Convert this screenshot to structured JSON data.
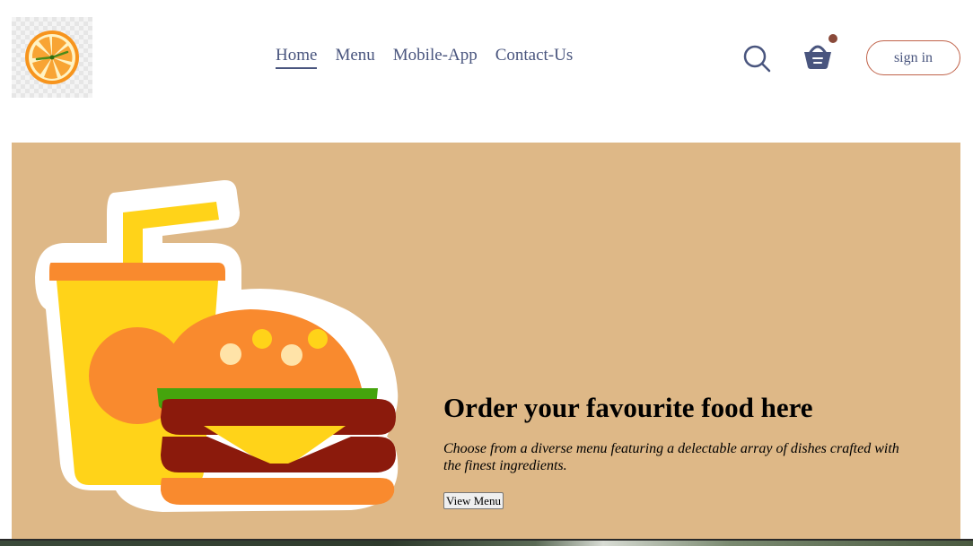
{
  "header": {
    "logo_icon": "orange-clock-logo",
    "nav": [
      {
        "label": "Home",
        "active": true
      },
      {
        "label": "Menu",
        "active": false
      },
      {
        "label": "Mobile-App",
        "active": false
      },
      {
        "label": "Contact-Us",
        "active": false
      }
    ],
    "search_icon": "search-icon",
    "basket_icon": "basket-icon",
    "signin_label": "sign in"
  },
  "hero": {
    "title": "Order your favourite food here",
    "description": "Choose from a diverse menu featuring a delectable array of dishes crafted with the finest ingredients.",
    "button_label": "View Menu",
    "illustration": "burger-and-drink"
  },
  "colors": {
    "nav_text": "#49557e",
    "hero_bg": "#deb887",
    "signin_border": "#c0634a",
    "cart_dot": "#8a4a3a"
  }
}
